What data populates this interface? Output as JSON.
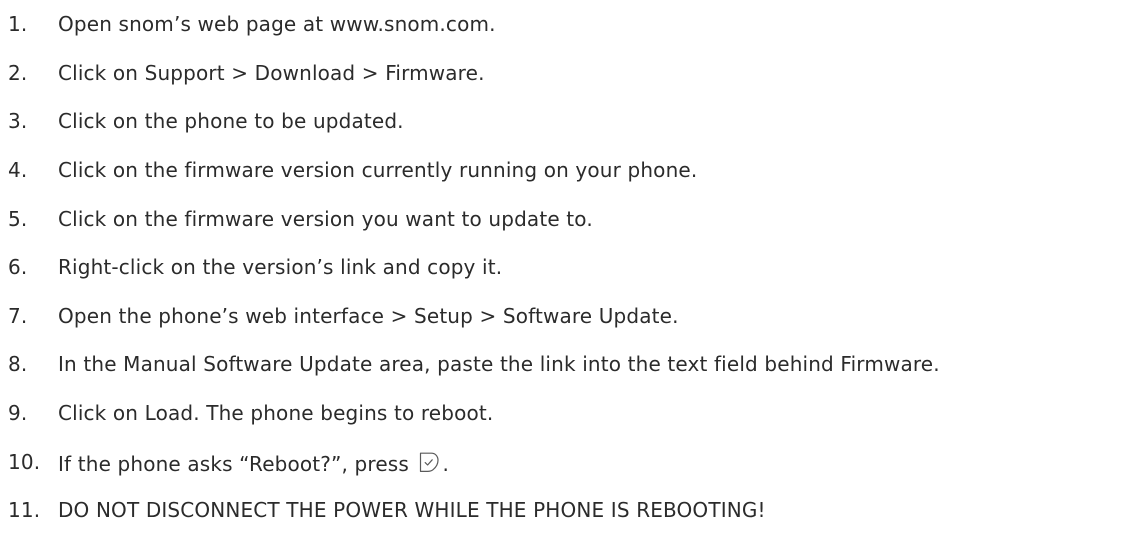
{
  "steps": [
    {
      "num": "1.",
      "text": "Open snom’s web page at www.snom.com."
    },
    {
      "num": "2.",
      "text": "Click on Support > Download > Firmware."
    },
    {
      "num": "3.",
      "text": "Click on the phone to be updated."
    },
    {
      "num": "4.",
      "text": "Click on the firmware version currently running on your phone."
    },
    {
      "num": "5.",
      "text": "Click on the firmware version you want to update to."
    },
    {
      "num": "6.",
      "text": "Right-click on the version’s link and copy it."
    },
    {
      "num": "7.",
      "text": "Open the phone’s web interface > Setup  > Software Update."
    },
    {
      "num": "8.",
      "text": "In the Manual Software Update area, paste the link into the text field behind Firmware."
    },
    {
      "num": "9.",
      "text": "Click on Load. The phone begins to reboot."
    },
    {
      "num": "10.",
      "text_before": "If the phone asks “Reboot?”, press",
      "icon": "check-key-icon",
      "text_after": "."
    },
    {
      "num": "11.",
      "text": "DO NOT DISCONNECT THE POWER WHILE THE PHONE IS REBOOTING!"
    }
  ]
}
